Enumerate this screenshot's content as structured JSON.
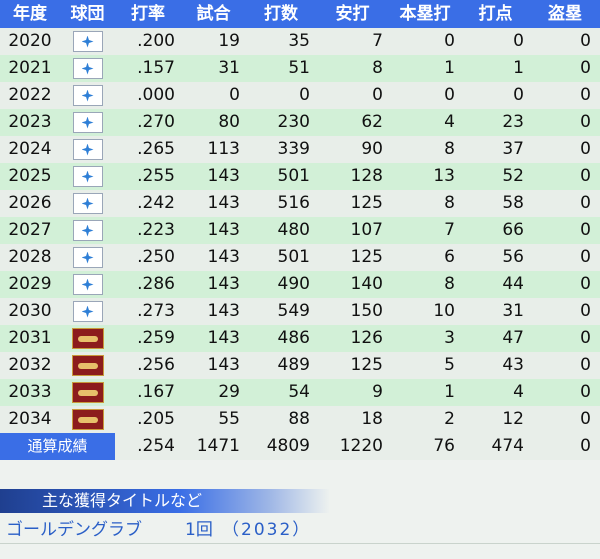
{
  "header": [
    "年度",
    "球団",
    "打率",
    "試合",
    "打数",
    "安打",
    "本塁打",
    "打点",
    "盗塁"
  ],
  "rows": [
    {
      "year": "2020",
      "team": "blue",
      "avg": ".200",
      "g": "19",
      "ab": "35",
      "h": "7",
      "hr": "0",
      "rbi": "0",
      "sb": "0"
    },
    {
      "year": "2021",
      "team": "blue",
      "avg": ".157",
      "g": "31",
      "ab": "51",
      "h": "8",
      "hr": "1",
      "rbi": "1",
      "sb": "0"
    },
    {
      "year": "2022",
      "team": "blue",
      "avg": ".000",
      "g": "0",
      "ab": "0",
      "h": "0",
      "hr": "0",
      "rbi": "0",
      "sb": "0"
    },
    {
      "year": "2023",
      "team": "blue",
      "avg": ".270",
      "g": "80",
      "ab": "230",
      "h": "62",
      "hr": "4",
      "rbi": "23",
      "sb": "0"
    },
    {
      "year": "2024",
      "team": "blue",
      "avg": ".265",
      "g": "113",
      "ab": "339",
      "h": "90",
      "hr": "8",
      "rbi": "37",
      "sb": "0"
    },
    {
      "year": "2025",
      "team": "blue",
      "avg": ".255",
      "g": "143",
      "ab": "501",
      "h": "128",
      "hr": "13",
      "rbi": "52",
      "sb": "0"
    },
    {
      "year": "2026",
      "team": "blue",
      "avg": ".242",
      "g": "143",
      "ab": "516",
      "h": "125",
      "hr": "8",
      "rbi": "58",
      "sb": "0"
    },
    {
      "year": "2027",
      "team": "blue",
      "avg": ".223",
      "g": "143",
      "ab": "480",
      "h": "107",
      "hr": "7",
      "rbi": "66",
      "sb": "0"
    },
    {
      "year": "2028",
      "team": "blue",
      "avg": ".250",
      "g": "143",
      "ab": "501",
      "h": "125",
      "hr": "6",
      "rbi": "56",
      "sb": "0"
    },
    {
      "year": "2029",
      "team": "blue",
      "avg": ".286",
      "g": "143",
      "ab": "490",
      "h": "140",
      "hr": "8",
      "rbi": "44",
      "sb": "0"
    },
    {
      "year": "2030",
      "team": "blue",
      "avg": ".273",
      "g": "143",
      "ab": "549",
      "h": "150",
      "hr": "10",
      "rbi": "31",
      "sb": "0"
    },
    {
      "year": "2031",
      "team": "red",
      "avg": ".259",
      "g": "143",
      "ab": "486",
      "h": "126",
      "hr": "3",
      "rbi": "47",
      "sb": "0"
    },
    {
      "year": "2032",
      "team": "red",
      "avg": ".256",
      "g": "143",
      "ab": "489",
      "h": "125",
      "hr": "5",
      "rbi": "43",
      "sb": "0"
    },
    {
      "year": "2033",
      "team": "red",
      "avg": ".167",
      "g": "29",
      "ab": "54",
      "h": "9",
      "hr": "1",
      "rbi": "4",
      "sb": "0"
    },
    {
      "year": "2034",
      "team": "red",
      "avg": ".205",
      "g": "55",
      "ab": "88",
      "h": "18",
      "hr": "2",
      "rbi": "12",
      "sb": "0"
    }
  ],
  "total": {
    "label": "通算成績",
    "avg": ".254",
    "g": "1471",
    "ab": "4809",
    "h": "1220",
    "hr": "76",
    "rbi": "474",
    "sb": "0"
  },
  "titles_section": {
    "heading": "主な獲得タイトルなど",
    "items": [
      {
        "name": "ゴールデングラブ",
        "count": "1回",
        "years": "（2032）"
      }
    ]
  },
  "colors": {
    "header_blue": "#3a6ee6",
    "row_green": "#d2f0d7",
    "row_gray": "#e8eee9",
    "title_text": "#2a5fc7"
  },
  "team_logo_icons": {
    "blue": "star-team-logo-icon",
    "red": "red-team-logo-icon"
  }
}
